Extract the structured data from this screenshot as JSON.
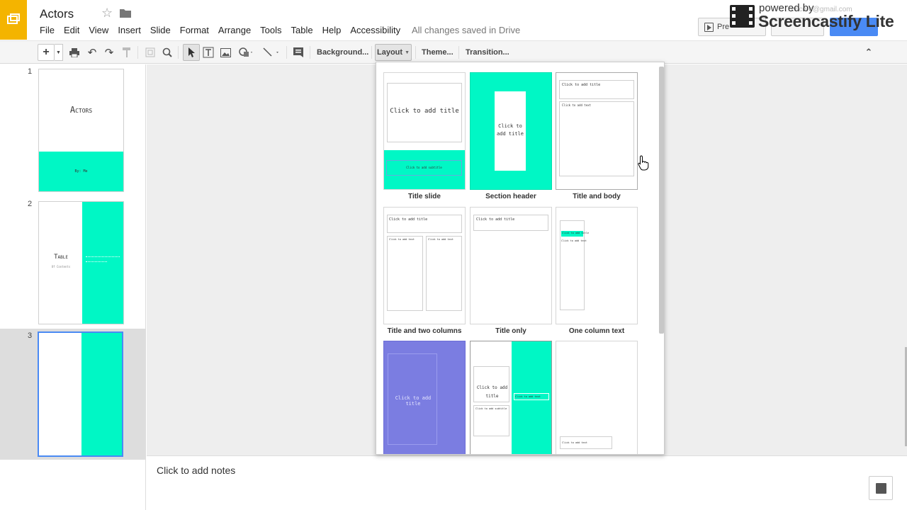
{
  "header": {
    "title": "Actors",
    "menu": [
      "File",
      "Edit",
      "View",
      "Insert",
      "Slide",
      "Format",
      "Arrange",
      "Tools",
      "Table",
      "Help",
      "Accessibility"
    ],
    "save_status": "All changes saved in Drive",
    "present_label": "Pre",
    "account_email": "...ericorn@gmail.com"
  },
  "watermark": {
    "line1": "powered by",
    "line2": "Screencastify Lite"
  },
  "toolbar": {
    "background": "Background...",
    "layout": "Layout",
    "theme": "Theme...",
    "transition": "Transition..."
  },
  "slides": [
    {
      "number": "1",
      "title": "Actors",
      "subtitle": "By: Me"
    },
    {
      "number": "2",
      "title": "Table",
      "subtitle": "Of Contents"
    },
    {
      "number": "3"
    }
  ],
  "layouts": [
    {
      "label": "Title slide",
      "placeholder_title": "Click to add title",
      "placeholder_subtitle": "Click to add subtitle"
    },
    {
      "label": "Section header",
      "placeholder_title": "Click to add title"
    },
    {
      "label": "Title and body",
      "placeholder_title": "Click to add title",
      "placeholder_text": "Click to add text"
    },
    {
      "label": "Title and two columns",
      "placeholder_title": "Click to add title",
      "placeholder_text": "Click to add text"
    },
    {
      "label": "Title only",
      "placeholder_title": "Click to add title"
    },
    {
      "label": "One column text",
      "placeholder_title": "Click to add title",
      "placeholder_text": "Click to add text"
    },
    {
      "label": "",
      "placeholder_title": "Click to add title"
    },
    {
      "label": "",
      "placeholder_title": "Click to add title",
      "placeholder_subtitle": "Click to add subtitle",
      "placeholder_text": "Click to add text"
    },
    {
      "label": "",
      "placeholder_text": "Click to add text"
    }
  ],
  "notes": {
    "placeholder": "Click to add notes"
  },
  "colors": {
    "accent_teal": "#00f7c5",
    "accent_purple": "#7b7de1",
    "slides_logo": "#f4b400",
    "share_blue": "#4a8af4"
  }
}
